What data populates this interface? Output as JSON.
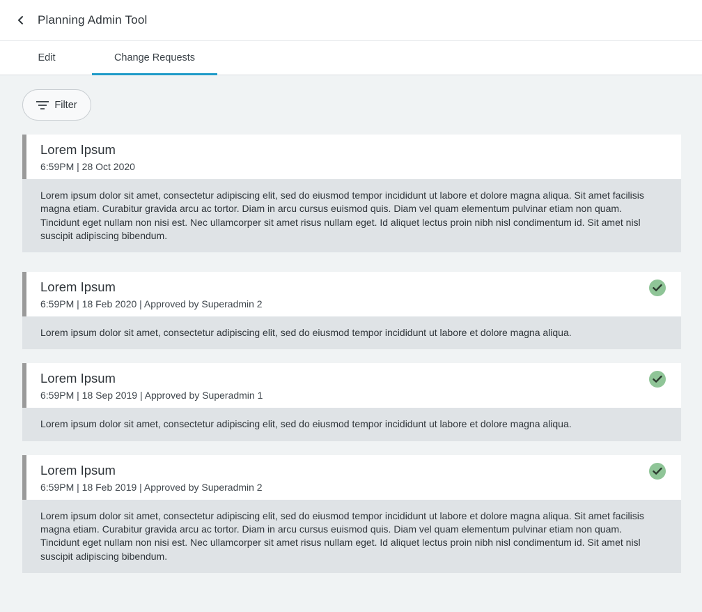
{
  "header": {
    "title": "Planning Admin Tool",
    "back_icon": "chevron-left-icon"
  },
  "tabs": [
    {
      "label": "Edit",
      "active": false
    },
    {
      "label": "Change Requests",
      "active": true
    }
  ],
  "filter": {
    "label": "Filter",
    "icon": "filter-icon"
  },
  "colors": {
    "accent": "#1f9bc8",
    "approved": "#8fc597",
    "card_border": "#9a9a9a"
  },
  "requests": [
    {
      "title": "Lorem Ipsum",
      "meta": "6:59PM | 28 Oct 2020",
      "approved": false,
      "body": "Lorem ipsum dolor sit amet, consectetur adipiscing elit, sed do eiusmod tempor incididunt ut labore et dolore magna aliqua. Sit amet facilisis magna etiam. Curabitur gravida arcu ac tortor. Diam in arcu cursus euismod quis. Diam vel quam elementum pulvinar etiam non quam. Tincidunt eget nullam non nisi est. Nec ullamcorper sit amet risus nullam eget. Id aliquet lectus proin nibh nisl condimentum id. Sit amet nisl suscipit adipiscing bibendum."
    },
    {
      "title": "Lorem Ipsum",
      "meta": "6:59PM | 18 Feb 2020 | Approved by Superadmin 2",
      "approved": true,
      "body": "Lorem ipsum dolor sit amet, consectetur adipiscing elit, sed do eiusmod tempor incididunt ut labore et dolore magna aliqua."
    },
    {
      "title": "Lorem Ipsum",
      "meta": "6:59PM | 18 Sep 2019 | Approved by Superadmin 1",
      "approved": true,
      "body": "Lorem ipsum dolor sit amet, consectetur adipiscing elit, sed do eiusmod tempor incididunt ut labore et dolore magna aliqua."
    },
    {
      "title": "Lorem Ipsum",
      "meta": "6:59PM | 18 Feb 2019 | Approved by Superadmin 2",
      "approved": true,
      "body": "Lorem ipsum dolor sit amet, consectetur adipiscing elit, sed do eiusmod tempor incididunt ut labore et dolore magna aliqua. Sit amet facilisis magna etiam. Curabitur gravida arcu ac tortor. Diam in arcu cursus euismod quis. Diam vel quam elementum pulvinar etiam non quam. Tincidunt eget nullam non nisi est. Nec ullamcorper sit amet risus nullam eget. Id aliquet lectus proin nibh nisl condimentum id. Sit amet nisl suscipit adipiscing bibendum."
    }
  ]
}
